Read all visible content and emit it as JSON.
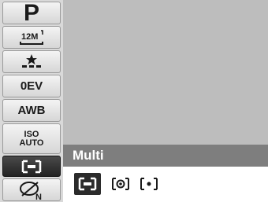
{
  "sidebar": {
    "items": [
      {
        "id": "mode",
        "label": "P"
      },
      {
        "id": "resolution",
        "label": "12M",
        "icon": "image-size-icon"
      },
      {
        "id": "quality",
        "label": "",
        "icon": "quality-stars-icon"
      },
      {
        "id": "ev",
        "label": "0EV"
      },
      {
        "id": "white-balance",
        "label": "AWB"
      },
      {
        "id": "iso",
        "label_line1": "ISO",
        "label_line2": "AUTO"
      },
      {
        "id": "metering",
        "label": "",
        "icon": "metering-multi-icon",
        "selected": true
      },
      {
        "id": "color",
        "label": "",
        "icon": "color-mode-normal-icon"
      }
    ]
  },
  "metering_menu": {
    "current_label": "Multi",
    "options": [
      {
        "name": "multi",
        "icon": "metering-multi-icon",
        "selected": true
      },
      {
        "name": "center",
        "icon": "metering-center-icon",
        "selected": false
      },
      {
        "name": "spot",
        "icon": "metering-spot-icon",
        "selected": false
      }
    ]
  },
  "colors": {
    "label_bar": "#7e7e7e",
    "preview": "#bdbdbd",
    "selected": "#2b2b2b"
  }
}
